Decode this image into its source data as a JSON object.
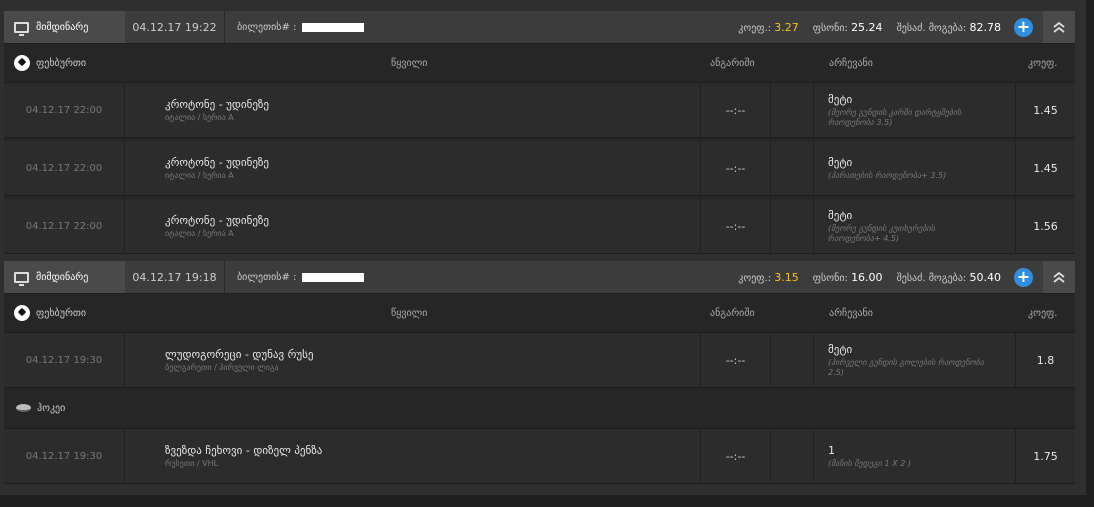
{
  "bets": [
    {
      "status": "მიმდინარე",
      "date": "04.12.17 19:22",
      "ticket_label": "ბილეთის# :",
      "odds_label": "კოეფ.:",
      "odds": "3.27",
      "stake_label": "ფსონი:",
      "stake": "25.24",
      "win_label": "შესაძ. მოგება:",
      "win": "82.78",
      "columns": {
        "sport": "ფეხბურთი",
        "event": "წყვილი",
        "score": "ანგარიში",
        "choice": "არჩევანი",
        "odds": "კოეფ."
      },
      "rows": [
        {
          "date": "04.12.17 22:00",
          "event": "კროტონე - უდინეზე",
          "league": "იტალია / სერია A",
          "score": "--:--",
          "pick": "მეტი",
          "desc": "(მეორე გუნდის კარში დარტყმების რაოდენობა 3.5)",
          "odds": "1.45"
        },
        {
          "date": "04.12.17 22:00",
          "event": "კროტონე - უდინეზე",
          "league": "იტალია / სერია A",
          "score": "--:--",
          "pick": "მეტი",
          "desc": "(პარათების რაოდენობა+ 3.5)",
          "odds": "1.45"
        },
        {
          "date": "04.12.17 22:00",
          "event": "კროტონე - უდინეზე",
          "league": "იტალია / სერია A",
          "score": "--:--",
          "pick": "მეტი",
          "desc": "(მეორე გუნდის კუთხურების რაოდენობა+ 4.5)",
          "odds": "1.56"
        }
      ]
    },
    {
      "status": "მიმდინარე",
      "date": "04.12.17 19:18",
      "ticket_label": "ბილეთის# :",
      "odds_label": "კოეფ.:",
      "odds": "3.15",
      "stake_label": "ფსონი:",
      "stake": "16.00",
      "win_label": "შესაძ. მოგება:",
      "win": "50.40",
      "columns": {
        "sport": "ფეხბურთი",
        "event": "წყვილი",
        "score": "ანგარიში",
        "choice": "არჩევანი",
        "odds": "კოეფ."
      },
      "rows": [
        {
          "date": "04.12.17 19:30",
          "event": "ლუდოგორეცი - დუნავ რუსე",
          "league": "ბულგარეთი / პირველი ლიგა",
          "score": "--:--",
          "pick": "მეტი",
          "desc": "(პირველი გუნდის გოლების რაოდენობა 2.5)",
          "odds": "1.8"
        }
      ],
      "sport2": "ჰოკეი",
      "rows2": [
        {
          "date": "04.12.17 19:30",
          "event": "ზვეზდა ჩეხოვი - დიზელ პენზა",
          "league": "რუსეთი / VHL",
          "score": "--:--",
          "pick": "1",
          "desc": "(მაჩის შედეგი 1 X 2 )",
          "odds": "1.75"
        }
      ]
    }
  ]
}
